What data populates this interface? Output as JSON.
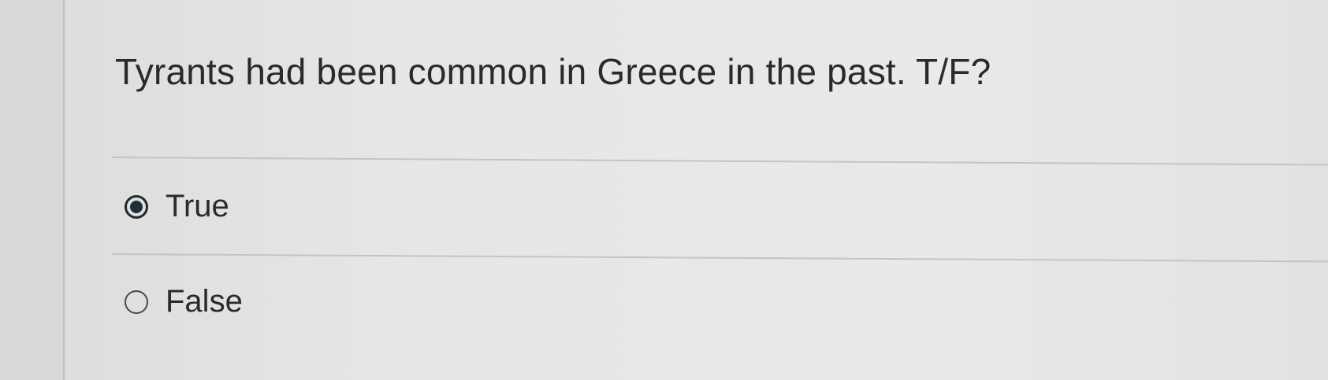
{
  "question": {
    "text": "Tyrants had been common in Greece in the past. T/F?"
  },
  "options": [
    {
      "label": "True",
      "selected": true
    },
    {
      "label": "False",
      "selected": false
    }
  ]
}
